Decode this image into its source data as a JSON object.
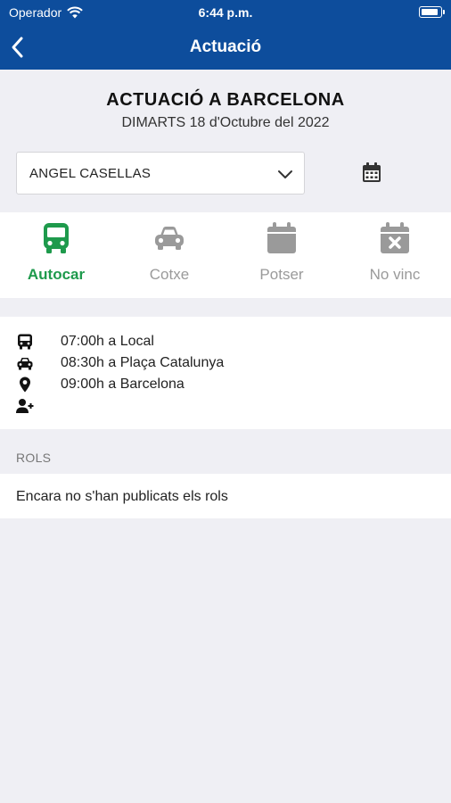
{
  "status_bar": {
    "carrier": "Operador",
    "time": "6:44 p.m."
  },
  "nav": {
    "title": "Actuació",
    "back_icon": "chevron-left-icon"
  },
  "event": {
    "title": "ACTUACIÓ A BARCELONA",
    "date": "DIMARTS 18 d'Octubre del 2022"
  },
  "member_select": {
    "value": "ANGEL CASELLAS"
  },
  "transport_options": [
    {
      "label": "Autocar",
      "icon": "bus-icon",
      "active": true
    },
    {
      "label": "Cotxe",
      "icon": "car-icon",
      "active": false
    },
    {
      "label": "Potser",
      "icon": "calendar-icon",
      "active": false
    },
    {
      "label": "No vinc",
      "icon": "calendar-x-icon",
      "active": false
    }
  ],
  "details": [
    {
      "icon": "bus-icon",
      "text": "07:00h a Local"
    },
    {
      "icon": "car-icon",
      "text": "08:30h a Plaça Catalunya"
    },
    {
      "icon": "map-pin-icon",
      "text": "09:00h a Barcelona"
    },
    {
      "icon": "user-plus-icon",
      "text": ""
    }
  ],
  "roles": {
    "header": "ROLS",
    "message": "Encara no s'han publicats els rols"
  },
  "colors": {
    "header_blue": "#0d4d9c",
    "active_green": "#1e9a4c",
    "inactive_gray": "#9a9a9a",
    "background": "#efeff4"
  }
}
